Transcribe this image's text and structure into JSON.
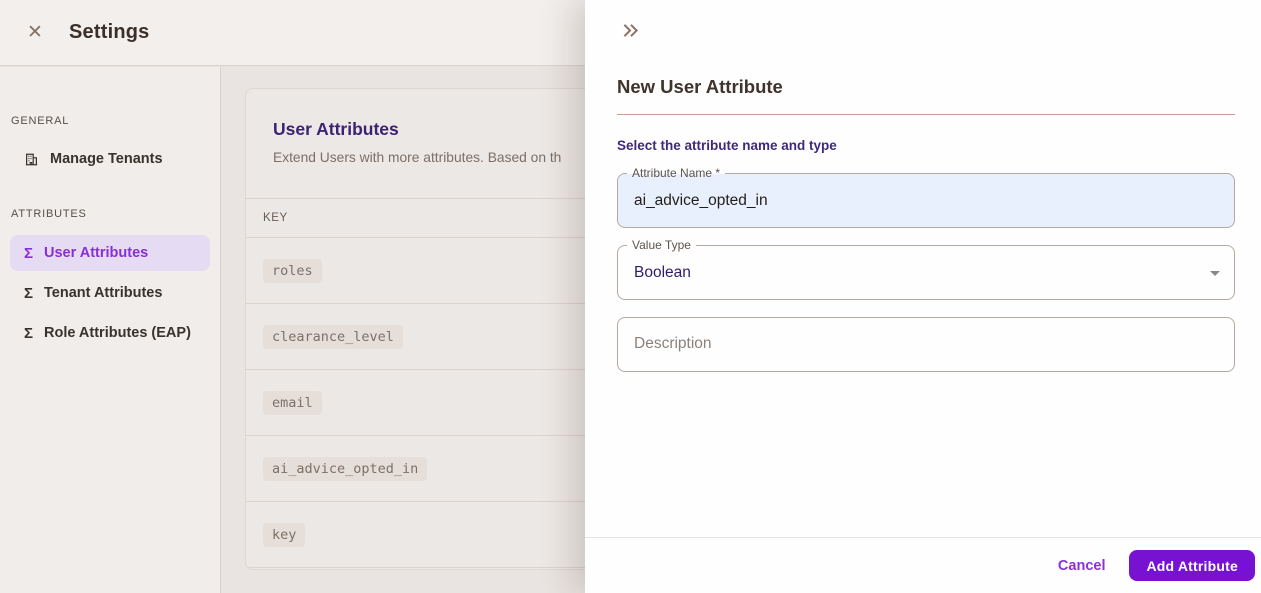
{
  "icons": {
    "close": "✕",
    "sigma": "Σ"
  },
  "colors": {
    "accent_button_purple": "#7712d3",
    "selected_item_purple": "#8a2ed8",
    "card_title_purple": "#3b2373",
    "autofill_blue": "#e7f0fc",
    "title_divider_tan": "#c2a08d"
  },
  "header": {
    "title": "Settings"
  },
  "sidebar": {
    "sections": [
      {
        "label": "GENERAL",
        "items": [
          {
            "icon": "building-icon",
            "label": "Manage Tenants",
            "selected": false
          }
        ]
      },
      {
        "label": "ATTRIBUTES",
        "items": [
          {
            "icon": "sigma-icon",
            "label": "User Attributes",
            "selected": true
          },
          {
            "icon": "sigma-icon",
            "label": "Tenant Attributes",
            "selected": false
          },
          {
            "icon": "sigma-icon",
            "label": "Role Attributes (EAP)",
            "selected": false
          }
        ]
      }
    ]
  },
  "main": {
    "card": {
      "title": "User Attributes",
      "subtitle": "Extend Users with more attributes. Based on th",
      "table": {
        "column_header": "KEY",
        "rows": [
          "roles",
          "clearance_level",
          "email",
          "ai_advice_opted_in",
          "key"
        ]
      }
    }
  },
  "drawer": {
    "title": "New User Attribute",
    "section_label": "Select the attribute name and type",
    "fields": {
      "attribute_name": {
        "label": "Attribute Name *",
        "value": "ai_advice_opted_in"
      },
      "value_type": {
        "label": "Value Type",
        "value": "Boolean"
      },
      "description": {
        "placeholder": "Description"
      }
    },
    "footer": {
      "cancel_label": "Cancel",
      "submit_label": "Add Attribute"
    }
  }
}
